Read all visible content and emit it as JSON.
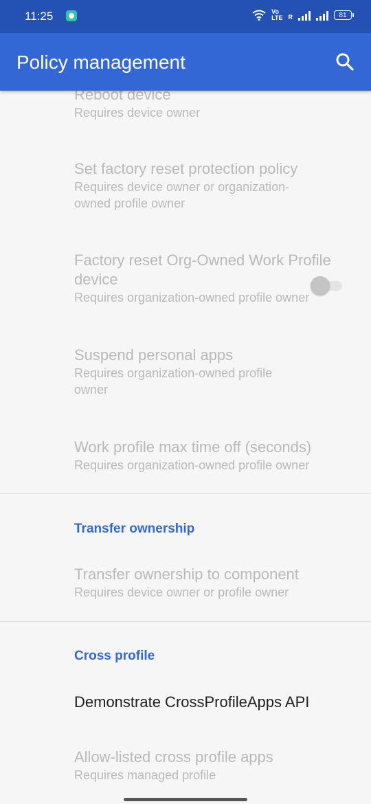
{
  "status_bar": {
    "time": "11:25",
    "app_icon": "chat-bubble-icon",
    "wifi_icon": "wifi-icon",
    "volte_top": "Vo",
    "volte_bottom": "LTE",
    "roaming_label": "R",
    "battery": "81"
  },
  "app_bar": {
    "title": "Policy management",
    "search_icon": "search-icon",
    "background": "#3367d6"
  },
  "items": [
    {
      "title": "Reboot device",
      "summary": "Requires device owner"
    },
    {
      "title": "Set factory reset protection policy",
      "summary": "Requires device owner or organization-owned profile owner"
    },
    {
      "title": "Factory reset Org-Owned Work Profile device",
      "summary": "Requires organization-owned profile owner"
    },
    {
      "title": "Suspend personal apps",
      "summary": "Requires organization-owned profile owner",
      "toggle_on": false
    },
    {
      "title": "Work profile max time off (seconds)",
      "summary": "Requires organization-owned profile owner"
    }
  ],
  "sections": [
    {
      "header": "Transfer ownership",
      "items": [
        {
          "title": "Transfer ownership to component",
          "summary": "Requires device owner or profile owner"
        }
      ]
    },
    {
      "header": "Cross profile",
      "items": [
        {
          "title": "Demonstrate CrossProfileApps API",
          "summary": ""
        },
        {
          "title": "Allow-listed cross profile apps",
          "summary": "Requires managed profile"
        }
      ]
    }
  ]
}
